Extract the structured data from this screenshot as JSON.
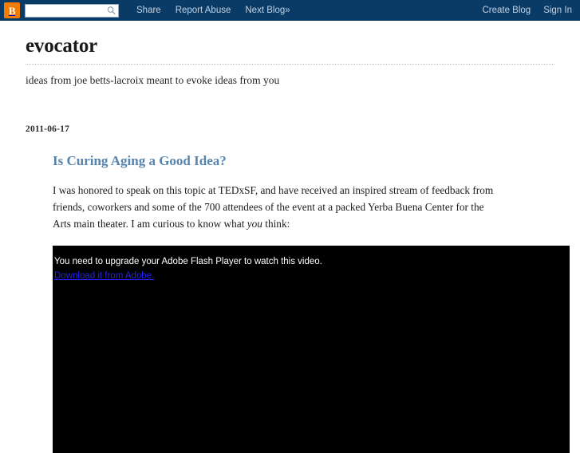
{
  "navbar": {
    "logo_icon": "blogger-b-icon",
    "logo_letter": "B",
    "search": {
      "value": "",
      "placeholder": "",
      "icon": "search-icon"
    },
    "links": [
      {
        "label": "Share"
      },
      {
        "label": "Report Abuse"
      },
      {
        "label": "Next Blog»"
      }
    ],
    "right_links": [
      {
        "label": "Create Blog"
      },
      {
        "label": "Sign In"
      }
    ]
  },
  "blog": {
    "title": "evocator",
    "description": "ideas from joe betts-lacroix meant to evoke ideas from you"
  },
  "post": {
    "date": "2011-06-17",
    "title": "Is Curing Aging a Good Idea?",
    "paragraph_part1": "I was honored to speak on this topic at TEDxSF, and have received an inspired stream of feedback from friends, coworkers and some of the 700 attendees of the event at a packed Yerba Buena Center for the Arts main theater. I am curious to know what ",
    "paragraph_emphasis": "you",
    "paragraph_part2": " think:"
  },
  "flash": {
    "message": "You need to upgrade your Adobe Flash Player to watch this video.",
    "link_label": "Download it from Adobe."
  },
  "colors": {
    "navbar_background": "#0a3a66",
    "logo_orange": "#f57c00",
    "post_title_blue": "#5784ad",
    "flash_background": "#000000",
    "flash_link_blue": "#2222ee"
  }
}
